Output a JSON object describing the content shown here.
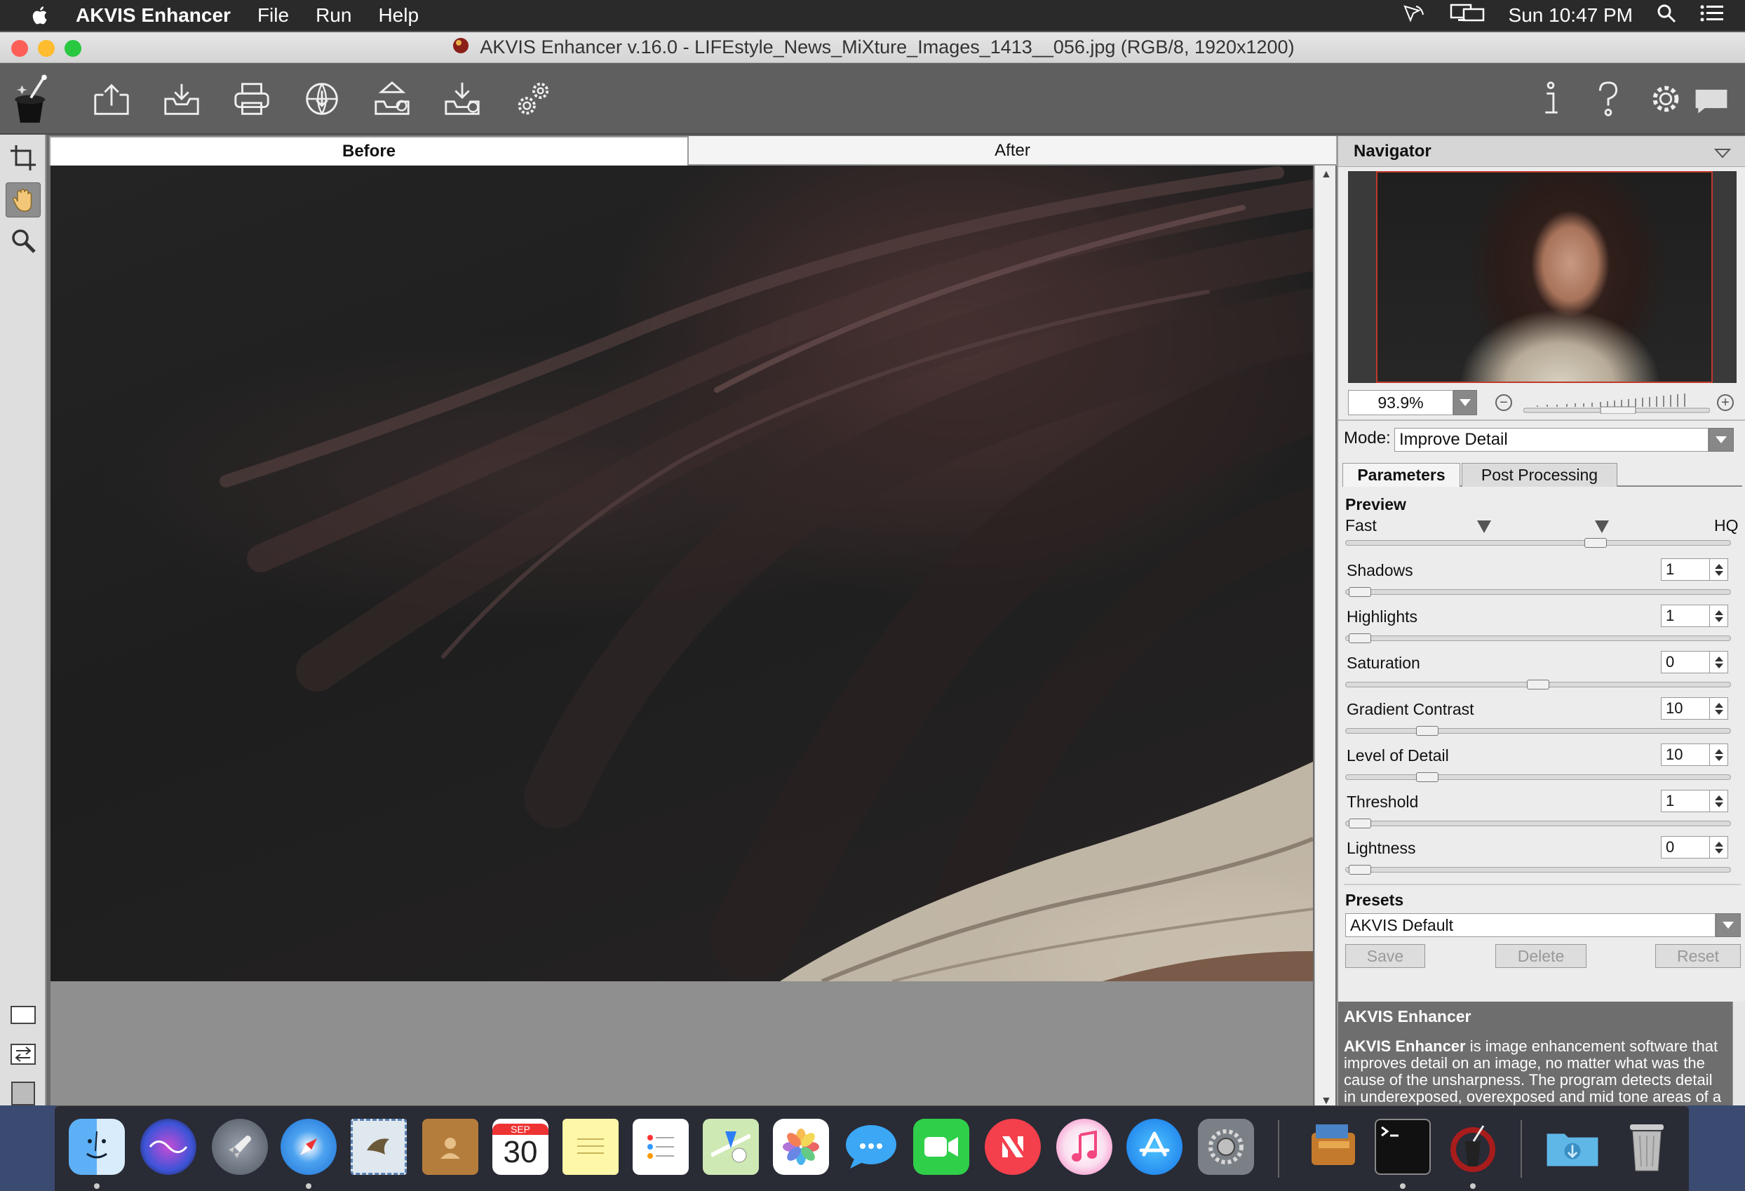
{
  "menubar": {
    "app_name": "AKVIS Enhancer",
    "items": [
      "File",
      "Run",
      "Help"
    ],
    "clock": "Sun 10:47 PM"
  },
  "window": {
    "title": "AKVIS Enhancer v.16.0 - LIFEstyle_News_MiXture_Images_1413__056.jpg (RGB/8, 1920x1200)"
  },
  "toolbar": {
    "left_icons": [
      "open-icon",
      "save-icon",
      "print-icon",
      "share-icon",
      "batch-icon",
      "plugin-icon",
      "settings-gears-icon"
    ],
    "right_icons": [
      "info-icon",
      "help-icon",
      "preferences-icon",
      "notification-icon"
    ]
  },
  "view_tabs": {
    "before": "Before",
    "after": "After",
    "active": "before"
  },
  "navigator": {
    "title": "Navigator",
    "zoom": "93.9%"
  },
  "mode": {
    "label": "Mode:",
    "value": "Improve Detail"
  },
  "param_tabs": {
    "parameters": "Parameters",
    "post_processing": "Post Processing"
  },
  "preview": {
    "title": "Preview",
    "fast": "Fast",
    "hq": "HQ"
  },
  "parameters": [
    {
      "name": "Shadows",
      "value": "1"
    },
    {
      "name": "Highlights",
      "value": "1"
    },
    {
      "name": "Saturation",
      "value": "0"
    },
    {
      "name": "Gradient Contrast",
      "value": "10"
    },
    {
      "name": "Level of Detail",
      "value": "10"
    },
    {
      "name": "Threshold",
      "value": "1"
    },
    {
      "name": "Lightness",
      "value": "0"
    }
  ],
  "presets": {
    "title": "Presets",
    "value": "AKVIS Default",
    "save": "Save",
    "delete": "Delete",
    "reset": "Reset"
  },
  "info": {
    "title": "AKVIS Enhancer",
    "bold": "AKVIS Enhancer",
    "text": " is image enhancement software that improves detail on an image, no matter what was the cause of the unsharpness. The program detects detail in underexposed, overexposed and mid tone areas of a photo with uneven exposure"
  },
  "dock": {
    "apps": [
      "Finder",
      "Siri",
      "Launchpad",
      "Safari",
      "Mail",
      "Contacts",
      "Calendar",
      "Notes",
      "Reminders",
      "Maps",
      "Photos",
      "Messages",
      "FaceTime",
      "News",
      "Music",
      "App Store",
      "System Preferences",
      "Books",
      "Terminal",
      "AKVIS",
      "Downloads",
      "Trash"
    ],
    "calendar_month": "SEP",
    "calendar_day": "30"
  },
  "colors": {
    "accent_red": "#c0392b",
    "toolbar_bg": "#5f5f5f",
    "panel_bg": "#ececec"
  }
}
